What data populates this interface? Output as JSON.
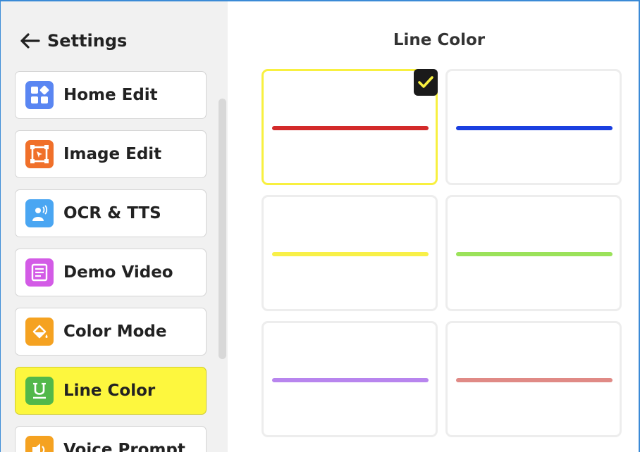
{
  "sidebar": {
    "title": "Settings",
    "back_icon": "arrow-left-icon",
    "items": [
      {
        "label": "Home Edit",
        "icon": "grid-shapes-icon",
        "icon_color": "#5a86f2",
        "active": false
      },
      {
        "label": "Image Edit",
        "icon": "image-crop-icon",
        "icon_color": "#f0702a",
        "active": false
      },
      {
        "label": "OCR & TTS",
        "icon": "speaker-person-icon",
        "icon_color": "#4aa6f2",
        "active": false
      },
      {
        "label": "Demo Video",
        "icon": "document-lines-icon",
        "icon_color": "#d35be6",
        "active": false
      },
      {
        "label": "Color Mode",
        "icon": "paint-bucket-icon",
        "icon_color": "#f5a221",
        "active": false
      },
      {
        "label": "Line Color",
        "icon": "underline-icon",
        "icon_color": "#52b84a",
        "active": true
      },
      {
        "label": "Voice Prompt",
        "icon": "volume-icon",
        "icon_color": "#f5a221",
        "active": false
      }
    ]
  },
  "main": {
    "title": "Line Color",
    "swatches": [
      {
        "color": "#d32a2a",
        "selected": true
      },
      {
        "color": "#1a3fe0",
        "selected": false
      },
      {
        "color": "#f8f048",
        "selected": false
      },
      {
        "color": "#9be25a",
        "selected": false
      },
      {
        "color": "#b885ee",
        "selected": false
      },
      {
        "color": "#e08a86",
        "selected": false
      }
    ],
    "check_icon": "checkmark-icon",
    "check_color": "#f8f040"
  },
  "colors": {
    "active_item_bg": "#fdf73e",
    "sidebar_bg": "#f1f1f1",
    "frame_border": "#3a8ad6"
  }
}
